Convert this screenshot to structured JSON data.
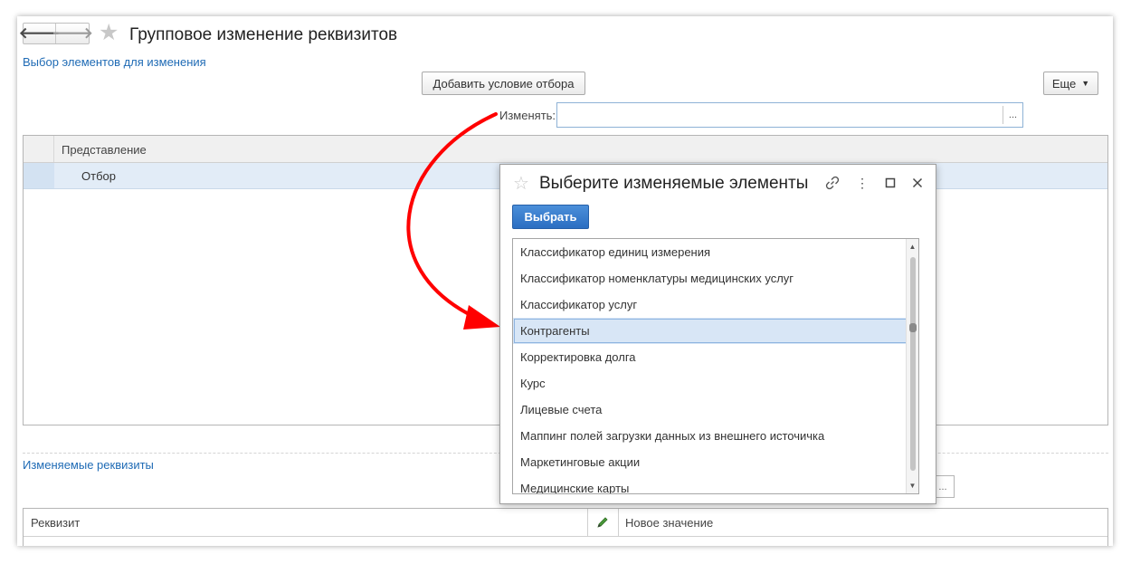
{
  "window": {
    "title": "Групповое изменение реквизитов",
    "nav": {
      "back_icon": "arrow-left-icon",
      "forward_icon": "arrow-right-icon"
    },
    "favorite_icon": "star-icon"
  },
  "selection_section": {
    "label": "Выбор элементов для изменения"
  },
  "toolbar": {
    "add_filter_label": "Добавить условие отбора",
    "more_label": "Еще"
  },
  "change_field": {
    "label": "Изменять:",
    "value": "",
    "select_button": "..."
  },
  "filter_grid": {
    "column_header": "Представление",
    "rows": [
      {
        "label": "Отбор"
      }
    ]
  },
  "attributes_section": {
    "label": "Изменяемые реквизиты",
    "grid": {
      "columns": [
        "Реквизит",
        "Новое значение"
      ],
      "edit_icon": "pencil-icon"
    },
    "hidden_field_button": "..."
  },
  "dialog": {
    "title": "Выберите изменяемые элементы",
    "icons": [
      "star-icon",
      "link-icon",
      "more-vertical-icon",
      "maximize-icon",
      "close-icon"
    ],
    "select_button": "Выбрать",
    "items": [
      "Классификатор единиц измерения",
      "Классификатор номенклатуры медицинских услуг",
      "Классификатор услуг",
      "Контрагенты",
      "Корректировка долга",
      "Курс",
      "Лицевые счета",
      "Маппинг полей загрузки данных из внешнего источичка",
      "Маркетинговые акции",
      "Медицинские карты"
    ],
    "selected_item": "Контрагенты"
  },
  "colors": {
    "link": "#1f6bb5",
    "primary_button": "#2b6ec2",
    "selection": "#d8e6f6",
    "annotation_arrow": "#ff0000"
  }
}
